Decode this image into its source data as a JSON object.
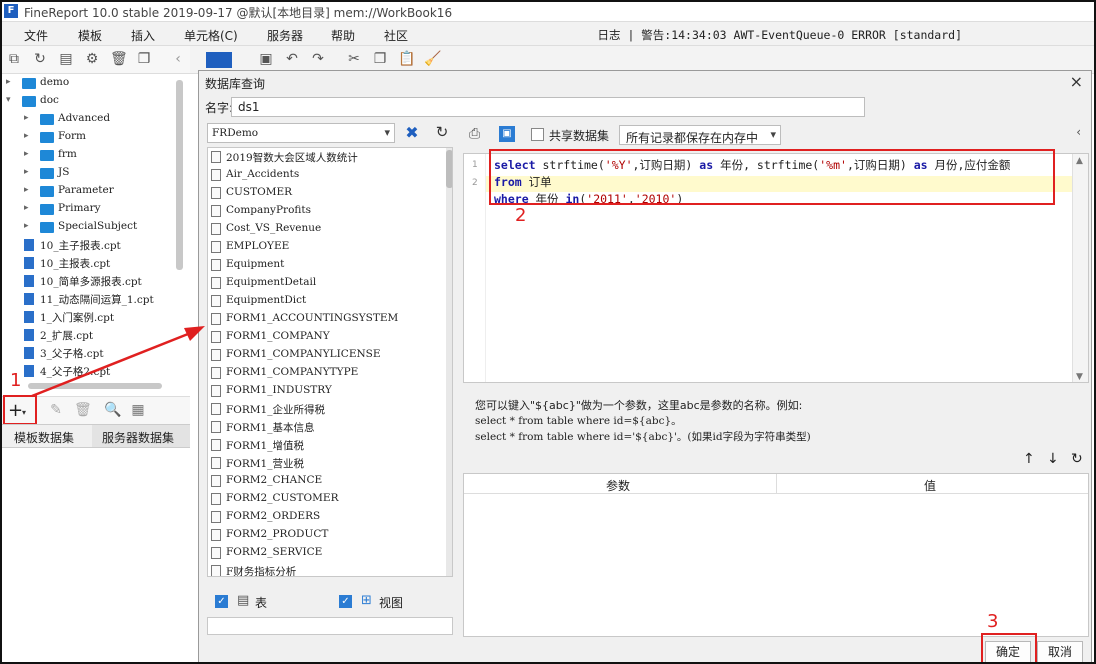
{
  "window": {
    "title": "FineReport 10.0 stable 2019-09-17 @默认[本地目录]     mem://WorkBook16",
    "logo": "F"
  },
  "menubar": {
    "items": [
      "文件",
      "模板",
      "插入",
      "单元格(C)",
      "服务器",
      "帮助",
      "社区"
    ],
    "status": "日志 | 警告:14:34:03 AWT-EventQueue-0 ERROR [standard]"
  },
  "tree": {
    "items": [
      {
        "label": "demo",
        "type": "folder",
        "level": 0,
        "state": "collapsed"
      },
      {
        "label": "doc",
        "type": "folder",
        "level": 0,
        "state": "expanded"
      },
      {
        "label": "Advanced",
        "type": "folder",
        "level": 1,
        "state": "collapsed"
      },
      {
        "label": "Form",
        "type": "folder",
        "level": 1,
        "state": "collapsed"
      },
      {
        "label": "frm",
        "type": "folder",
        "level": 1,
        "state": "collapsed"
      },
      {
        "label": "JS",
        "type": "folder",
        "level": 1,
        "state": "collapsed"
      },
      {
        "label": "Parameter",
        "type": "folder",
        "level": 1,
        "state": "collapsed"
      },
      {
        "label": "Primary",
        "type": "folder",
        "level": 1,
        "state": "collapsed"
      },
      {
        "label": "SpecialSubject",
        "type": "folder",
        "level": 1,
        "state": "collapsed"
      },
      {
        "label": "10_主子报表.cpt",
        "type": "file",
        "level": 1
      },
      {
        "label": "10_主报表.cpt",
        "type": "file",
        "level": 1
      },
      {
        "label": "10_简单多源报表.cpt",
        "type": "file",
        "level": 1
      },
      {
        "label": "11_动态隔间运算_1.cpt",
        "type": "file",
        "level": 1
      },
      {
        "label": "1_入门案例.cpt",
        "type": "file",
        "level": 1
      },
      {
        "label": "2_扩展.cpt",
        "type": "file",
        "level": 1
      },
      {
        "label": "3_父子格.cpt",
        "type": "file",
        "level": 1
      },
      {
        "label": "4_父子格2.cpt",
        "type": "file",
        "level": 1
      }
    ]
  },
  "dataset_panel": {
    "add_label": "+",
    "tabs": [
      "模板数据集",
      "服务器数据集"
    ]
  },
  "annotations": {
    "step1": "1",
    "step2": "2",
    "step3": "3"
  },
  "dialog": {
    "title": "数据库查询",
    "close": "×",
    "name_label": "名字:",
    "name_value": "ds1",
    "connection": "FRDemo",
    "tables": [
      "2019智数大会区域人数统计",
      "Air_Accidents",
      "CUSTOMER",
      "CompanyProfits",
      "Cost_VS_Revenue",
      "EMPLOYEE",
      "Equipment",
      "EquipmentDetail",
      "EquipmentDict",
      "FORM1_ACCOUNTINGSYSTEM",
      "FORM1_COMPANY",
      "FORM1_COMPANYLICENSE",
      "FORM1_COMPANYTYPE",
      "FORM1_INDUSTRY",
      "FORM1_企业所得税",
      "FORM1_基本信息",
      "FORM1_增值税",
      "FORM1_营业税",
      "FORM2_CHANCE",
      "FORM2_CUSTOMER",
      "FORM2_ORDERS",
      "FORM2_PRODUCT",
      "FORM2_SERVICE",
      "F财务指标分析"
    ],
    "show_tables_label": "表",
    "show_views_label": "视图",
    "share_label": "共享数据集",
    "memory_option": "所有记录都保存在内存中",
    "sql": {
      "line_numbers": [
        "1",
        "2"
      ],
      "line1": [
        {
          "t": "select",
          "c": "kw"
        },
        {
          "t": " strftime(",
          "c": ""
        },
        {
          "t": "'%Y'",
          "c": "str"
        },
        {
          "t": ",订购日期) ",
          "c": ""
        },
        {
          "t": "as",
          "c": "kw"
        },
        {
          "t": " 年份, strftime(",
          "c": ""
        },
        {
          "t": "'%m'",
          "c": "str"
        },
        {
          "t": ",订购日期) ",
          "c": ""
        },
        {
          "t": "as",
          "c": "kw"
        },
        {
          "t": " 月份,应付金额",
          "c": ""
        }
      ],
      "line2": [
        {
          "t": "from",
          "c": "kw"
        },
        {
          "t": " 订单",
          "c": ""
        }
      ],
      "line3": [
        {
          "t": "where",
          "c": "kw"
        },
        {
          "t": " 年份 ",
          "c": ""
        },
        {
          "t": "in",
          "c": "kw"
        },
        {
          "t": "(",
          "c": ""
        },
        {
          "t": "'2011'",
          "c": "str"
        },
        {
          "t": ",",
          "c": ""
        },
        {
          "t": "'2010'",
          "c": "str"
        },
        {
          "t": ")",
          "c": ""
        }
      ]
    },
    "hint": {
      "line1": "您可以键入\"${abc}\"做为一个参数，这里abc是参数的名称。例如:",
      "line2": "select * from table where id=${abc}。",
      "line3": "select * from table where id='${abc}'。(如果id字段为字符串类型)"
    },
    "param_headers": [
      "参数",
      "值"
    ],
    "ok_label": "确定",
    "cancel_label": "取消"
  }
}
